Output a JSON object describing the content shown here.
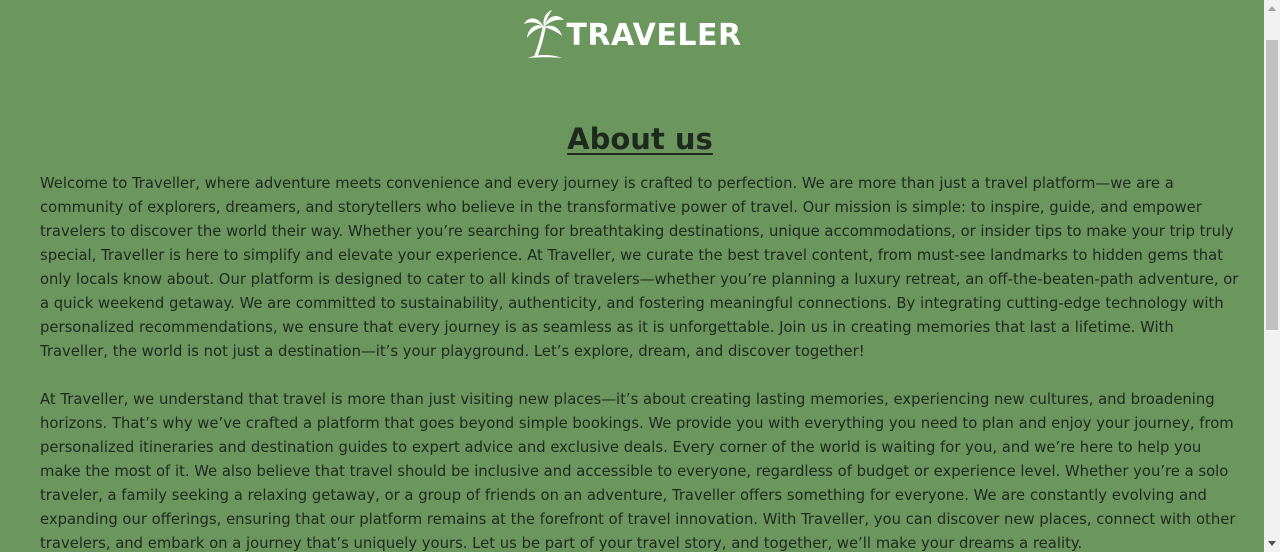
{
  "brand": {
    "name": "TRAVELER",
    "icon": "palm-tree-icon",
    "color": "#ffffff"
  },
  "page": {
    "background": "#6b965e",
    "title": "About us",
    "paragraphs": [
      "Welcome to Traveller, where adventure meets convenience and every journey is crafted to perfection. We are more than just a travel platform—we are a community of explorers, dreamers, and storytellers who believe in the transformative power of travel. Our mission is simple: to inspire, guide, and empower travelers to discover the world their way. Whether you’re searching for breathtaking destinations, unique accommodations, or insider tips to make your trip truly special, Traveller is here to simplify and elevate your experience. At Traveller, we curate the best travel content, from must-see landmarks to hidden gems that only locals know about. Our platform is designed to cater to all kinds of travelers—whether you’re planning a luxury retreat, an off-the-beaten-path adventure, or a quick weekend getaway. We are committed to sustainability, authenticity, and fostering meaningful connections. By integrating cutting-edge technology with personalized recommendations, we ensure that every journey is as seamless as it is unforgettable. Join us in creating memories that last a lifetime. With Traveller, the world is not just a destination—it’s your playground. Let’s explore, dream, and discover together!",
      "At Traveller, we understand that travel is more than just visiting new places—it’s about creating lasting memories, experiencing new cultures, and broadening horizons. That’s why we’ve crafted a platform that goes beyond simple bookings. We provide you with everything you need to plan and enjoy your journey, from personalized itineraries and destination guides to expert advice and exclusive deals. Every corner of the world is waiting for you, and we’re here to help you make the most of it. We also believe that travel should be inclusive and accessible to everyone, regardless of budget or experience level. Whether you’re a solo traveler, a family seeking a relaxing getaway, or a group of friends on an adventure, Traveller offers something for everyone. We are constantly evolving and expanding our offerings, ensuring that our platform remains at the forefront of travel innovation. With Traveller, you can discover new places, connect with other travelers, and embark on a journey that’s uniquely yours. Let us be part of your travel story, and together, we’ll make your dreams a reality."
    ]
  },
  "scrollbar": {
    "up_icon": "scroll-up-arrow-icon",
    "down_icon": "scroll-down-arrow-icon"
  }
}
